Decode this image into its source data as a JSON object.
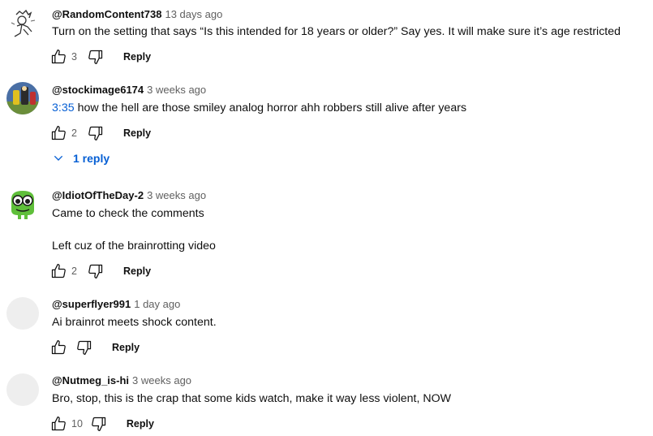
{
  "comments": [
    {
      "author": "@RandomContent738",
      "time": "13 days ago",
      "text": "Turn on the setting that says “Is this intended for 18 years or older?” Say yes. It will make sure it’s age restricted",
      "likes": "3",
      "reply_label": "Reply",
      "avatar": "sketch-avatar"
    },
    {
      "author": "@stockimage6174",
      "time": "3 weeks ago",
      "timestamp_link": "3:35",
      "text": " how the hell are those smiley analog horror ahh robbers still alive after years",
      "likes": "2",
      "reply_label": "Reply",
      "replies_label": "1 reply",
      "avatar": "figures-avatar"
    },
    {
      "author": "@IdiotOfTheDay-2",
      "time": "3 weeks ago",
      "text_line1": "Came to check the comments",
      "text_line2": "Left cuz of the brainrotting video",
      "likes": "2",
      "reply_label": "Reply",
      "avatar": "green-creature-avatar"
    },
    {
      "author": "@superflyer991",
      "time": "1 day ago",
      "text": "Ai brainrot meets shock content.",
      "likes": "",
      "reply_label": "Reply",
      "avatar": "blank-avatar"
    },
    {
      "author": "@Nutmeg_is-hi",
      "time": "3 weeks ago",
      "text": "Bro, stop, this is the crap that some kids watch, make it way less violent, NOW",
      "likes": "10",
      "reply_label": "Reply",
      "avatar": "blank-avatar"
    }
  ],
  "colors": {
    "link": "#065fd4",
    "meta": "#606060",
    "text": "#0f0f0f",
    "placeholder_avatar": "#eeeeee"
  },
  "icons": [
    "thumb-up-icon",
    "thumb-down-icon",
    "chevron-down-icon"
  ]
}
